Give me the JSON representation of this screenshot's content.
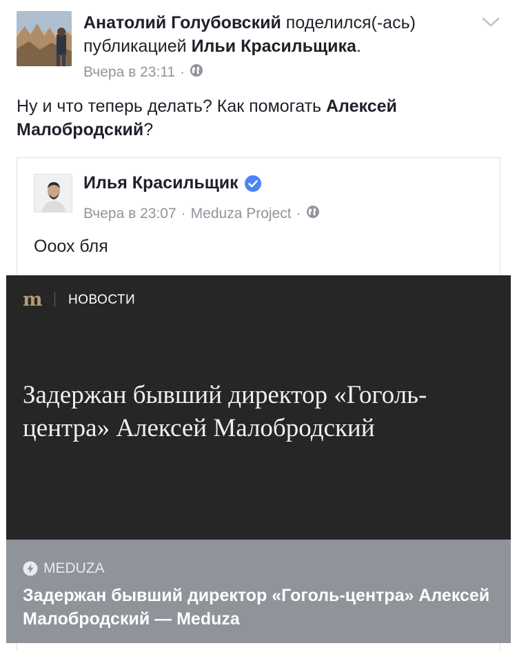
{
  "post": {
    "author_name": "Анатолий Голубовский",
    "share_verb": "поделился(-ась)",
    "share_obj": "публикацией",
    "shared_owner": "Ильи Красильщика",
    "period": ".",
    "time": "Вчера в 23:11",
    "separator": "·",
    "text_before": "Ну и что теперь делать? Как помогать ",
    "text_bold": "Алексей Малобродский",
    "text_after": "?"
  },
  "shared_post": {
    "author": "Илья Красильщик",
    "time": "Вчера в 23:07",
    "separator": "·",
    "source": "Meduza Project",
    "text": "Ооох бля"
  },
  "link_preview": {
    "logo": "m",
    "section": "НОВОСТИ",
    "headline": "Задержан бывший директор «Гоголь-центра» Алексей Малобродский",
    "domain": "MEDUZA",
    "title": "Задержан бывший директор «Гоголь-центра» Алексей Малобродский — Meduza"
  },
  "icons": {
    "chevron": "chevron-down-icon",
    "privacy": "globe-icon",
    "verified": "verified-badge-icon",
    "source": "lightning-icon"
  },
  "colors": {
    "text": "#1d2129",
    "meta": "#90949c",
    "verified": "#4c84f6",
    "image_bg": "#262626",
    "caption_bg": "#8f939a",
    "logo_gold": "#b79b6e"
  }
}
